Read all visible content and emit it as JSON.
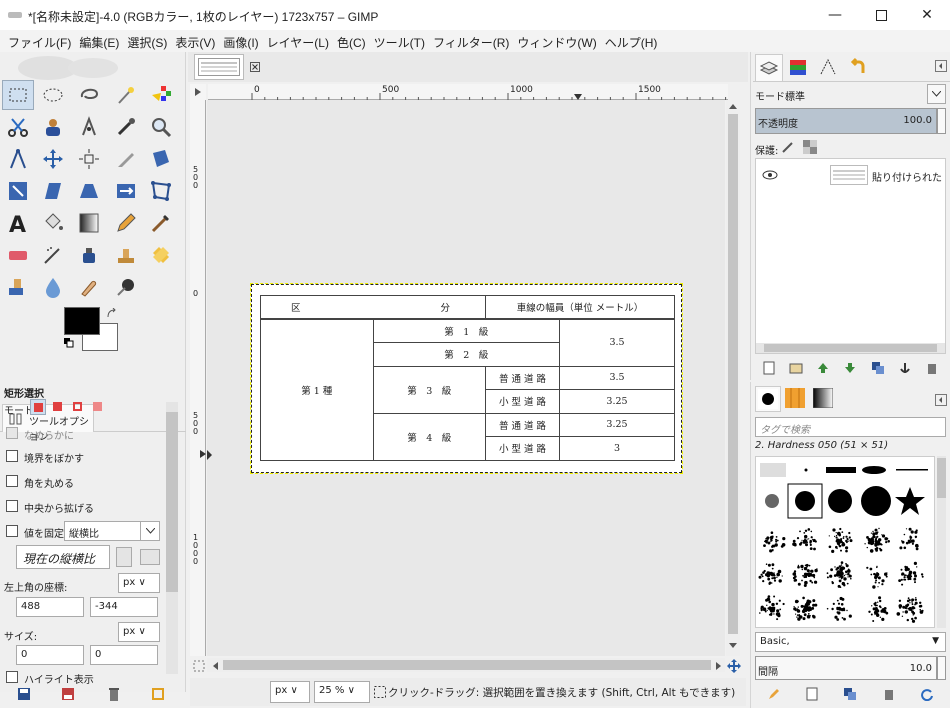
{
  "window": {
    "title": "*[名称未設定]-4.0 (RGBカラー, 1枚のレイヤー) 1723x757 – GIMP",
    "min_glyph": "—",
    "max_glyph": "☐",
    "close_glyph": "✕"
  },
  "menu": [
    "ファイル(F)",
    "編集(E)",
    "選択(S)",
    "表示(V)",
    "画像(I)",
    "レイヤー(L)",
    "色(C)",
    "ツール(T)",
    "フィルター(R)",
    "ウィンドウ(W)",
    "ヘルプ(H)"
  ],
  "tool_options": {
    "tab_label": "ツールオプション",
    "section_title": "矩形選択",
    "mode_label": "モード:",
    "antialias_label": "なめらかに",
    "feather_label": "境界をぼかす",
    "round_label": "角を丸める",
    "expand_center_label": "中央から拡げる",
    "fixed_label": "値を固定",
    "fixed_value": "縦横比",
    "aspect_button": "現在の縦横比",
    "position_label": "左上角の座標:",
    "position_unit": "px",
    "pos_x": "488",
    "pos_y": "-344",
    "size_label": "サイズ:",
    "size_unit": "px",
    "size_w": "0",
    "size_h": "0",
    "highlight_label": "ハイライト表示"
  },
  "canvas": {
    "ruler_h": [
      "0",
      "500",
      "1000",
      "1500"
    ],
    "ruler_v": [
      "5\n0\n0",
      "0",
      "5\n0\n0",
      "1\n0\n0\n0"
    ],
    "zoom_unit": "px",
    "zoom": "25 %",
    "status": "クリック-ドラッグ: 選択範囲を置き換えます (Shift, Ctrl, Alt もできます)"
  },
  "table_image": {
    "header": [
      "区",
      "分",
      "車線の幅員（単位 メートル）"
    ],
    "class_label": "第 1 種",
    "rows": [
      {
        "grade": "第　1　級",
        "road": "",
        "width": "3.5"
      },
      {
        "grade": "第　2　級",
        "road": "",
        "width": ""
      },
      {
        "grade": "第　3　級",
        "road": "普 通 道 路",
        "width": "3.5"
      },
      {
        "grade": "",
        "road": "小 型 道 路",
        "width": "3.25"
      },
      {
        "grade": "第　4　級",
        "road": "普 通 道 路",
        "width": "3.25"
      },
      {
        "grade": "",
        "road": "小 型 道 路",
        "width": "3"
      }
    ]
  },
  "layers": {
    "mode_label": "モード:",
    "mode_value": "標準",
    "opacity_label": "不透明度",
    "opacity_value": "100.0",
    "lock_label": "保護:",
    "layer_name": "貼り付けられたレイ"
  },
  "brushes": {
    "tag_placeholder": "タグで検索",
    "current_brush": "2. Hardness 050 (51 × 51)",
    "preset": "Basic,",
    "spacing_label": "間隔",
    "spacing_value": "10.0"
  },
  "colors": {
    "accent": "#cfdff0",
    "opacity_bar": "#b8c4d0"
  }
}
